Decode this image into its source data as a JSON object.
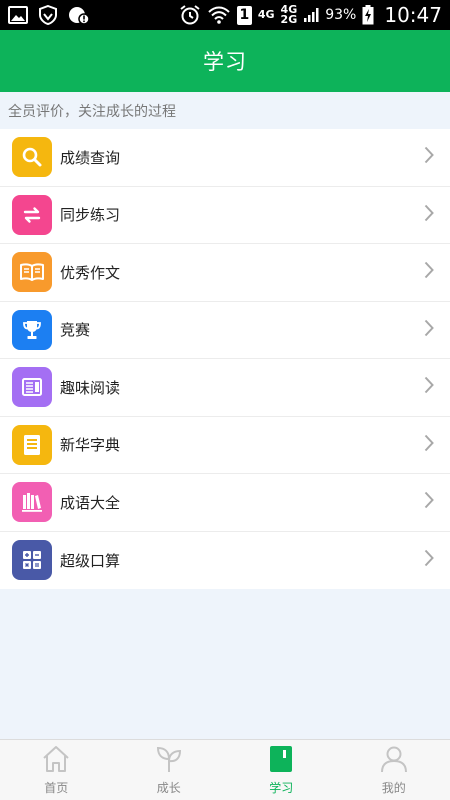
{
  "status_bar": {
    "battery_percent": "93%",
    "time": "10:47",
    "sim_badge": "1",
    "network_top": "4G",
    "network_mid": "4G",
    "network_bottom": "2G"
  },
  "header": {
    "title": "学习"
  },
  "subtitle": "全员评价，关注成长的过程",
  "menu": {
    "items": [
      {
        "label": "成绩查询",
        "icon": "search-icon",
        "color": "#f5b70f"
      },
      {
        "label": "同步练习",
        "icon": "sync-icon",
        "color": "#f4468f"
      },
      {
        "label": "优秀作文",
        "icon": "open-book-icon",
        "color": "#f89a2c"
      },
      {
        "label": "竞赛",
        "icon": "trophy-icon",
        "color": "#1c7ff2"
      },
      {
        "label": "趣味阅读",
        "icon": "reading-icon",
        "color": "#a46ff3"
      },
      {
        "label": "新华字典",
        "icon": "dictionary-icon",
        "color": "#f5b70f"
      },
      {
        "label": "成语大全",
        "icon": "books-icon",
        "color": "#f25fb3"
      },
      {
        "label": "超级口算",
        "icon": "calculator-icon",
        "color": "#4959a7"
      }
    ]
  },
  "tabs": [
    {
      "label": "首页",
      "icon": "home-icon",
      "active": false
    },
    {
      "label": "成长",
      "icon": "sprout-icon",
      "active": false
    },
    {
      "label": "学习",
      "icon": "notebook-icon",
      "active": true
    },
    {
      "label": "我的",
      "icon": "person-icon",
      "active": false
    }
  ],
  "colors": {
    "brand_green": "#0db35a",
    "background": "#eef4fb"
  }
}
